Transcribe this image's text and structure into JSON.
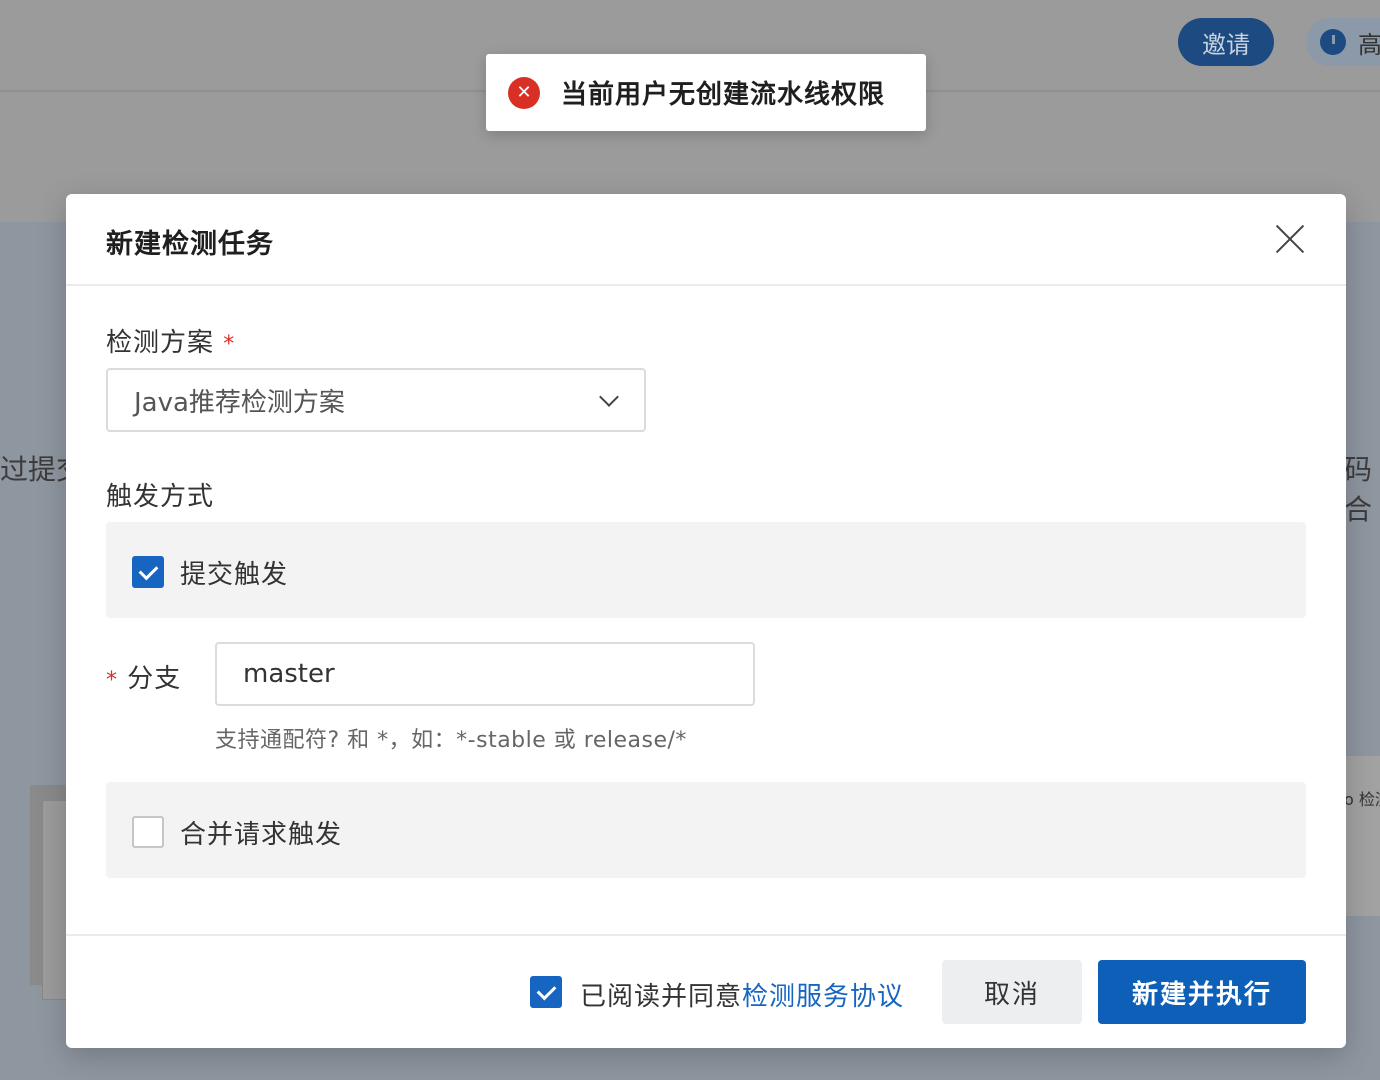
{
  "background": {
    "invite_label": "邀请",
    "pill_label": "高",
    "left_text": "过提交",
    "right_text": "码合",
    "right_card_text": "o 检测"
  },
  "toast": {
    "icon": "error-circle-icon",
    "message": "当前用户无创建流水线权限"
  },
  "modal": {
    "title": "新建检测任务",
    "scheme_label": "检测方案",
    "required_mark": "*",
    "scheme_value": "Java推荐检测方案",
    "trigger_label": "触发方式",
    "commit_trigger": {
      "label": "提交触发",
      "checked": true
    },
    "branch_label": "分支",
    "branch_value": "master",
    "branch_hint": "支持通配符? 和 *，如：*-stable 或 release/*",
    "merge_trigger": {
      "label": "合并请求触发",
      "checked": false
    },
    "agree": {
      "checked": true,
      "text": "已阅读并同意",
      "link": "检测服务协议"
    },
    "cancel_label": "取消",
    "submit_label": "新建并执行"
  },
  "colors": {
    "primary": "#0d5fb8",
    "error": "#d93026",
    "link": "#1665c0"
  }
}
